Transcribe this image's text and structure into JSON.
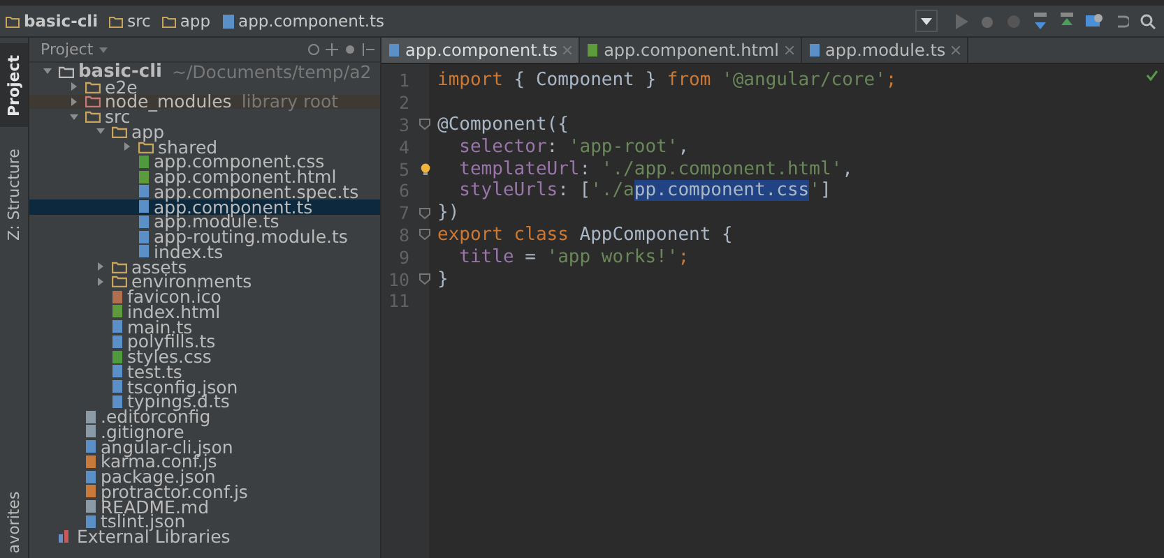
{
  "breadcrumbs": [
    {
      "label": "basic-cli",
      "kind": "folder",
      "bold": true
    },
    {
      "label": "src",
      "kind": "folder",
      "bold": false
    },
    {
      "label": "app",
      "kind": "folder",
      "bold": false
    },
    {
      "label": "app.component.ts",
      "kind": "ts",
      "bold": false
    }
  ],
  "tool_strip": [
    {
      "label": "Project",
      "selected": true
    },
    {
      "label": "Z: Structure",
      "selected": false
    },
    {
      "label": "avorites",
      "selected": false
    }
  ],
  "project_panel": {
    "title": "Project",
    "tree": [
      {
        "name": "basic-cli",
        "suffix": "~/Documents/temp/a2",
        "kind": "folder",
        "expanded": true,
        "selected": false,
        "children": [
          {
            "name": "e2e",
            "kind": "folder",
            "expanded": false,
            "selected": false
          },
          {
            "name": "node_modules",
            "suffix": "library root",
            "kind": "library",
            "expanded": false,
            "selected": false
          },
          {
            "name": "src",
            "kind": "folder",
            "expanded": true,
            "selected": false,
            "children": [
              {
                "name": "app",
                "kind": "folder",
                "expanded": true,
                "selected": false,
                "children": [
                  {
                    "name": "shared",
                    "kind": "folder",
                    "expanded": false,
                    "selected": false
                  },
                  {
                    "name": "app.component.css",
                    "kind": "css",
                    "selected": false
                  },
                  {
                    "name": "app.component.html",
                    "kind": "html",
                    "selected": false
                  },
                  {
                    "name": "app.component.spec.ts",
                    "kind": "spec",
                    "selected": false
                  },
                  {
                    "name": "app.component.ts",
                    "kind": "ts",
                    "selected": true
                  },
                  {
                    "name": "app.module.ts",
                    "kind": "ts",
                    "selected": false
                  },
                  {
                    "name": "app-routing.module.ts",
                    "kind": "ts",
                    "selected": false
                  },
                  {
                    "name": "index.ts",
                    "kind": "ts",
                    "selected": false
                  }
                ]
              },
              {
                "name": "assets",
                "kind": "folder",
                "expanded": false,
                "selected": false
              },
              {
                "name": "environments",
                "kind": "folder",
                "expanded": false,
                "selected": false
              },
              {
                "name": "favicon.ico",
                "kind": "ico",
                "selected": false
              },
              {
                "name": "index.html",
                "kind": "html",
                "selected": false
              },
              {
                "name": "main.ts",
                "kind": "ts",
                "selected": false
              },
              {
                "name": "polyfills.ts",
                "kind": "ts",
                "selected": false
              },
              {
                "name": "styles.css",
                "kind": "css",
                "selected": false
              },
              {
                "name": "test.ts",
                "kind": "ts",
                "selected": false
              },
              {
                "name": "tsconfig.json",
                "kind": "json",
                "selected": false
              },
              {
                "name": "typings.d.ts",
                "kind": "ts",
                "selected": false
              }
            ]
          },
          {
            "name": ".editorconfig",
            "kind": "file",
            "selected": false
          },
          {
            "name": ".gitignore",
            "kind": "file",
            "selected": false
          },
          {
            "name": "angular-cli.json",
            "kind": "json",
            "selected": false
          },
          {
            "name": "karma.conf.js",
            "kind": "js",
            "selected": false
          },
          {
            "name": "package.json",
            "kind": "json",
            "selected": false
          },
          {
            "name": "protractor.conf.js",
            "kind": "js",
            "selected": false
          },
          {
            "name": "README.md",
            "kind": "file",
            "selected": false
          },
          {
            "name": "tslint.json",
            "kind": "json",
            "selected": false
          }
        ]
      },
      {
        "name": "External Libraries",
        "kind": "lib",
        "selected": false
      }
    ]
  },
  "editor_tabs": [
    {
      "label": "app.component.ts",
      "kind": "ts",
      "selected": true
    },
    {
      "label": "app.component.html",
      "kind": "html",
      "selected": false
    },
    {
      "label": "app.module.ts",
      "kind": "ts",
      "selected": false
    }
  ],
  "code_lines": [
    {
      "number": "1",
      "fold": false,
      "bulb": false,
      "tokens": [
        {
          "kind": "kw",
          "text": "import"
        },
        {
          "kind": "plain",
          "text": " { Component } "
        },
        {
          "kind": "kw",
          "text": "from"
        },
        {
          "kind": "str",
          "text": " '@angular/core'"
        },
        {
          "kind": "kw",
          "text": ";"
        }
      ]
    },
    {
      "number": "2",
      "fold": false,
      "bulb": false
    },
    {
      "number": "3",
      "fold": true,
      "bulb": false,
      "tokens": [
        {
          "kind": "plain",
          "text": "@Component({"
        }
      ]
    },
    {
      "number": "4",
      "fold": false,
      "bulb": false,
      "tokens": [
        {
          "kind": "prop",
          "text": "  selector"
        },
        {
          "kind": "plain",
          "text": ": "
        },
        {
          "kind": "str",
          "text": "'app-root'"
        },
        {
          "kind": "plain",
          "text": ","
        }
      ]
    },
    {
      "number": "5",
      "fold": false,
      "bulb": true,
      "tokens": [
        {
          "kind": "prop",
          "text": "  templateUrl"
        },
        {
          "kind": "plain",
          "text": ": "
        },
        {
          "kind": "str",
          "text": "'./app.component.html'"
        },
        {
          "kind": "plain",
          "text": ","
        }
      ]
    },
    {
      "number": "6",
      "fold": false,
      "bulb": false,
      "tokens": [
        {
          "kind": "prop",
          "text": "  styleUrls"
        },
        {
          "kind": "plain",
          "text": ": ["
        },
        {
          "kind": "str",
          "text": "'./a"
        },
        {
          "kind": "sel",
          "text": "pp.component.css"
        },
        {
          "kind": "str",
          "text": "'"
        },
        {
          "kind": "plain",
          "text": "]"
        }
      ]
    },
    {
      "number": "7",
      "fold": true,
      "bulb": false,
      "tokens": [
        {
          "kind": "plain",
          "text": "})"
        }
      ]
    },
    {
      "number": "8",
      "fold": true,
      "bulb": false,
      "tokens": [
        {
          "kind": "kw",
          "text": "export class"
        },
        {
          "kind": "plain",
          "text": " AppComponent {"
        }
      ]
    },
    {
      "number": "9",
      "fold": false,
      "bulb": false,
      "tokens": [
        {
          "kind": "prop",
          "text": "  title"
        },
        {
          "kind": "plain",
          "text": " = "
        },
        {
          "kind": "str",
          "text": "'app works!'"
        },
        {
          "kind": "kw",
          "text": ";"
        }
      ]
    },
    {
      "number": "10",
      "fold": true,
      "bulb": false,
      "tokens": [
        {
          "kind": "plain",
          "text": "}"
        }
      ]
    },
    {
      "number": "11",
      "fold": false,
      "bulb": false
    }
  ]
}
